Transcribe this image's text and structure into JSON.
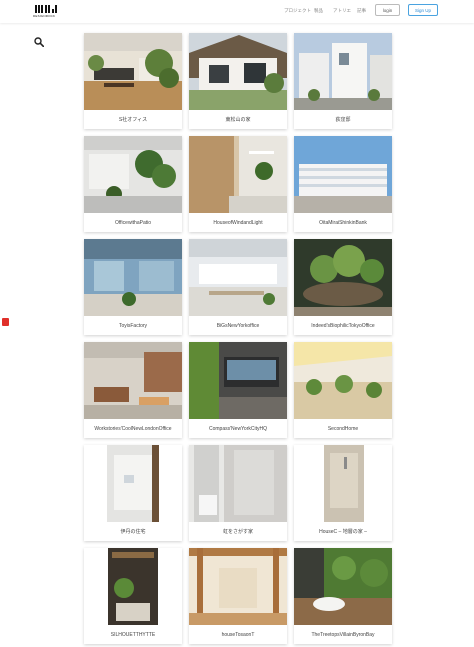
{
  "header": {
    "logo_text": "DESIGNROCK",
    "nav": [
      "プロジェクト",
      "製品",
      "アトリエ",
      "記事"
    ],
    "login_label": "login",
    "signup_label": "Sign Up"
  },
  "search": {
    "icon": "search-icon"
  },
  "projects": [
    {
      "title": "S社オフィス"
    },
    {
      "title": "東松山の家"
    },
    {
      "title": "荻窪邸"
    },
    {
      "title": "OfficewithaPatio"
    },
    {
      "title": "HouseofWindandLight"
    },
    {
      "title": "OitaMiraiShinkinBank"
    },
    {
      "title": "ToyisFactory"
    },
    {
      "title": "BiGsNewYorkoffice"
    },
    {
      "title": "Indeed'sBiophilicTokyoOffice"
    },
    {
      "title": "Workstories'CoolNewLondonOffice"
    },
    {
      "title": "Compass'NewYorkCityHQ"
    },
    {
      "title": "SecondHome"
    },
    {
      "title": "伊丹の住宅"
    },
    {
      "title": "虹をさがす家"
    },
    {
      "title": "HouseC – 地層の家 –"
    },
    {
      "title": "SILHOUETTHYTTE"
    },
    {
      "title": "houseTosaonT"
    },
    {
      "title": "TheTreetopsVillainByronBay"
    }
  ]
}
